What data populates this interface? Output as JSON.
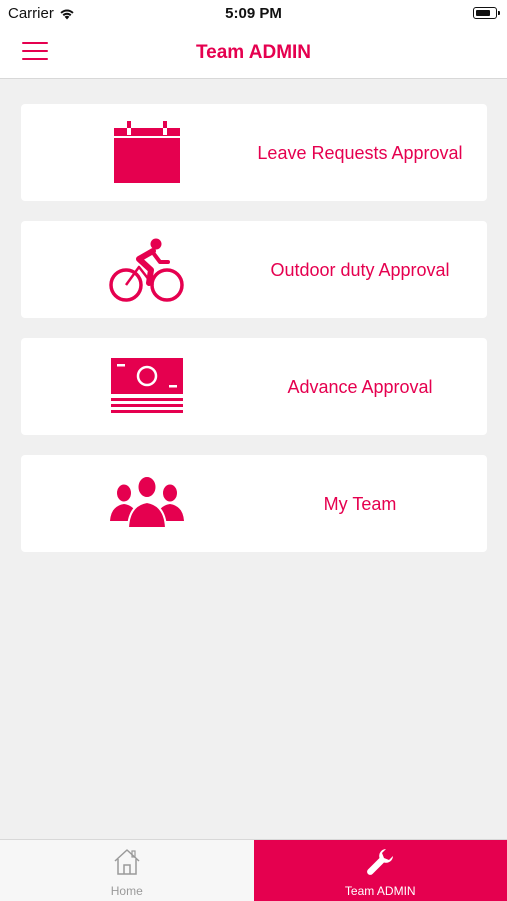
{
  "status_bar": {
    "carrier": "Carrier",
    "time": "5:09 PM"
  },
  "nav": {
    "title": "Team ADMIN"
  },
  "menu": {
    "items": [
      {
        "label": "Leave Requests Approval",
        "icon": "calendar-icon"
      },
      {
        "label": "Outdoor duty Approval",
        "icon": "cyclist-icon"
      },
      {
        "label": "Advance Approval",
        "icon": "money-icon"
      },
      {
        "label": "My Team",
        "icon": "team-icon"
      }
    ]
  },
  "tab_bar": {
    "tabs": [
      {
        "label": "Home",
        "icon": "home-icon",
        "active": false
      },
      {
        "label": "Team ADMIN",
        "icon": "wrench-icon",
        "active": true
      }
    ]
  },
  "colors": {
    "accent": "#e5004f",
    "background": "#f0f0f0",
    "card": "#ffffff"
  }
}
